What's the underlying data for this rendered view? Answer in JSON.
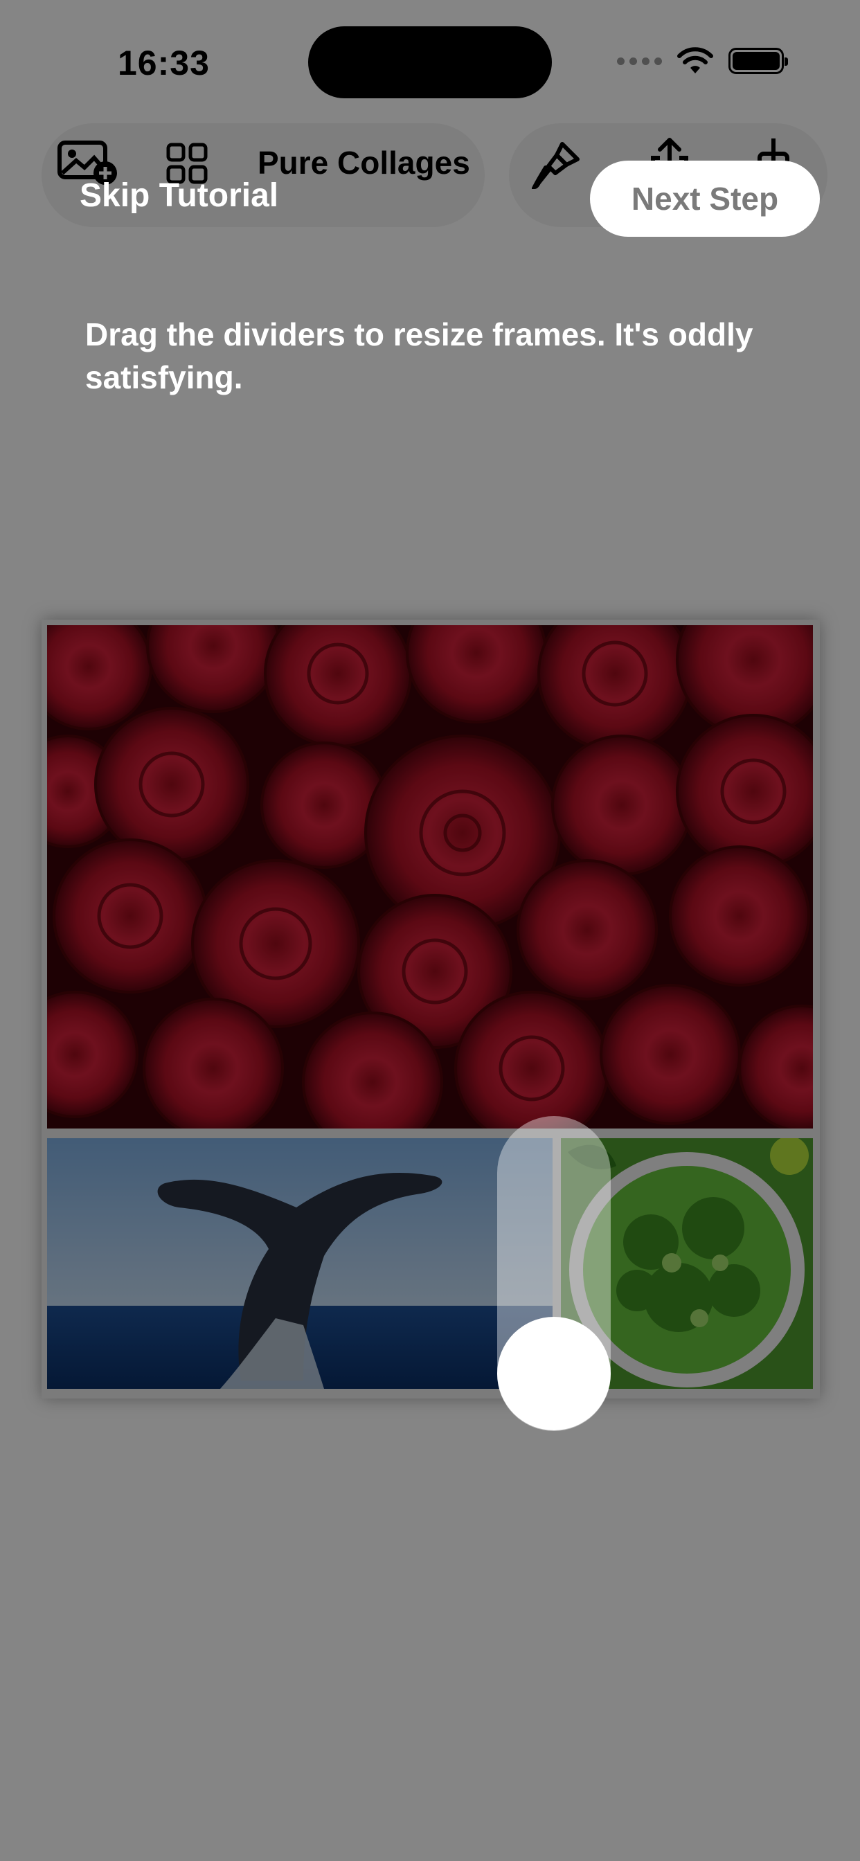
{
  "status_bar": {
    "time": "16:33"
  },
  "toolbar": {
    "title": "Pure Collages",
    "icons": [
      "add-photo-icon",
      "layout-grid-icon",
      "brush-icon",
      "share-icon",
      "adjust-icon"
    ]
  },
  "tutorial": {
    "skip_label": "Skip Tutorial",
    "next_label": "Next Step",
    "instruction": "Drag the dividers to resize frames. It's oddly satisfying."
  },
  "collage": {
    "frames": [
      "roses-photo",
      "whale-photo",
      "salad-photo"
    ]
  },
  "colors": {
    "overlay": "#000000",
    "spotlight": "#ffffff",
    "next_text": "#7a7a7a"
  }
}
